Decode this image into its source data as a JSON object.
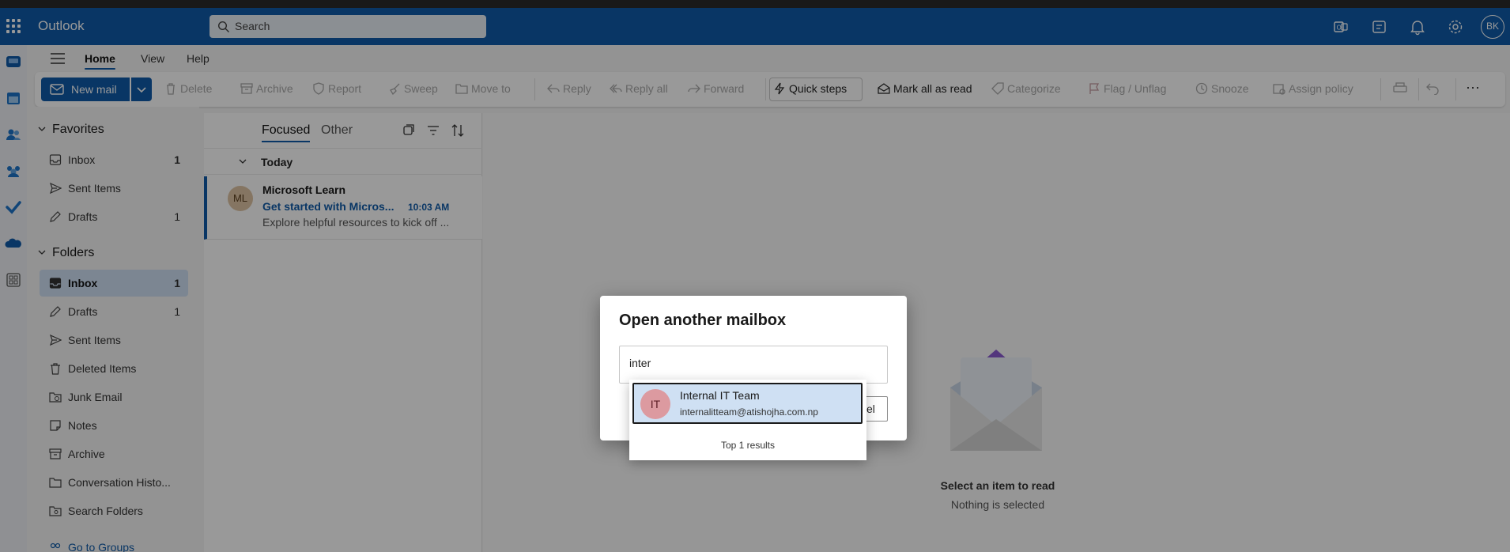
{
  "app": {
    "name": "Outlook",
    "user_initials": "BK"
  },
  "search": {
    "placeholder": "Search"
  },
  "nav_tabs": [
    "Home",
    "View",
    "Help"
  ],
  "ribbon": {
    "new_mail": "New mail",
    "delete": "Delete",
    "archive": "Archive",
    "report": "Report",
    "sweep": "Sweep",
    "move_to": "Move to",
    "reply": "Reply",
    "reply_all": "Reply all",
    "forward": "Forward",
    "quick_steps": "Quick steps",
    "mark_all_read": "Mark all as read",
    "categorize": "Categorize",
    "flag": "Flag / Unflag",
    "snooze": "Snooze",
    "assign_policy": "Assign policy",
    "more": "···"
  },
  "favorites": {
    "title": "Favorites",
    "items": [
      {
        "name": "Inbox",
        "count": "1"
      },
      {
        "name": "Sent Items",
        "count": ""
      },
      {
        "name": "Drafts",
        "count": "1"
      }
    ]
  },
  "folders": {
    "title": "Folders",
    "items": [
      {
        "name": "Inbox",
        "count": "1"
      },
      {
        "name": "Drafts",
        "count": "1"
      },
      {
        "name": "Sent Items",
        "count": ""
      },
      {
        "name": "Deleted Items",
        "count": ""
      },
      {
        "name": "Junk Email",
        "count": ""
      },
      {
        "name": "Notes",
        "count": ""
      },
      {
        "name": "Archive",
        "count": ""
      },
      {
        "name": "Conversation Histo...",
        "count": ""
      },
      {
        "name": "Search Folders",
        "count": ""
      },
      {
        "name": "Go to Groups",
        "count": ""
      }
    ]
  },
  "message_list": {
    "tab_focused": "Focused",
    "tab_other": "Other",
    "group": "Today",
    "messages": [
      {
        "initials": "ML",
        "sender": "Microsoft Learn",
        "subject": "Get started with Micros...",
        "time": "10:03 AM",
        "preview": "Explore helpful resources to kick off ..."
      }
    ]
  },
  "reading_pane": {
    "title": "Select an item to read",
    "subtitle": "Nothing is selected"
  },
  "dialog": {
    "title": "Open another mailbox",
    "input_value": "inter",
    "button_partial": "el"
  },
  "suggestions": {
    "items": [
      {
        "initials": "IT",
        "name": "Internal IT Team",
        "email": "internalitteam@atishojha.com.np"
      }
    ],
    "footer": "Top 1 results"
  },
  "colors": {
    "brand": "#0f5ba8",
    "selected": "#cfe0f3",
    "avatar_ml": "#dec4a3",
    "avatar_it": "#dc9aa0"
  }
}
